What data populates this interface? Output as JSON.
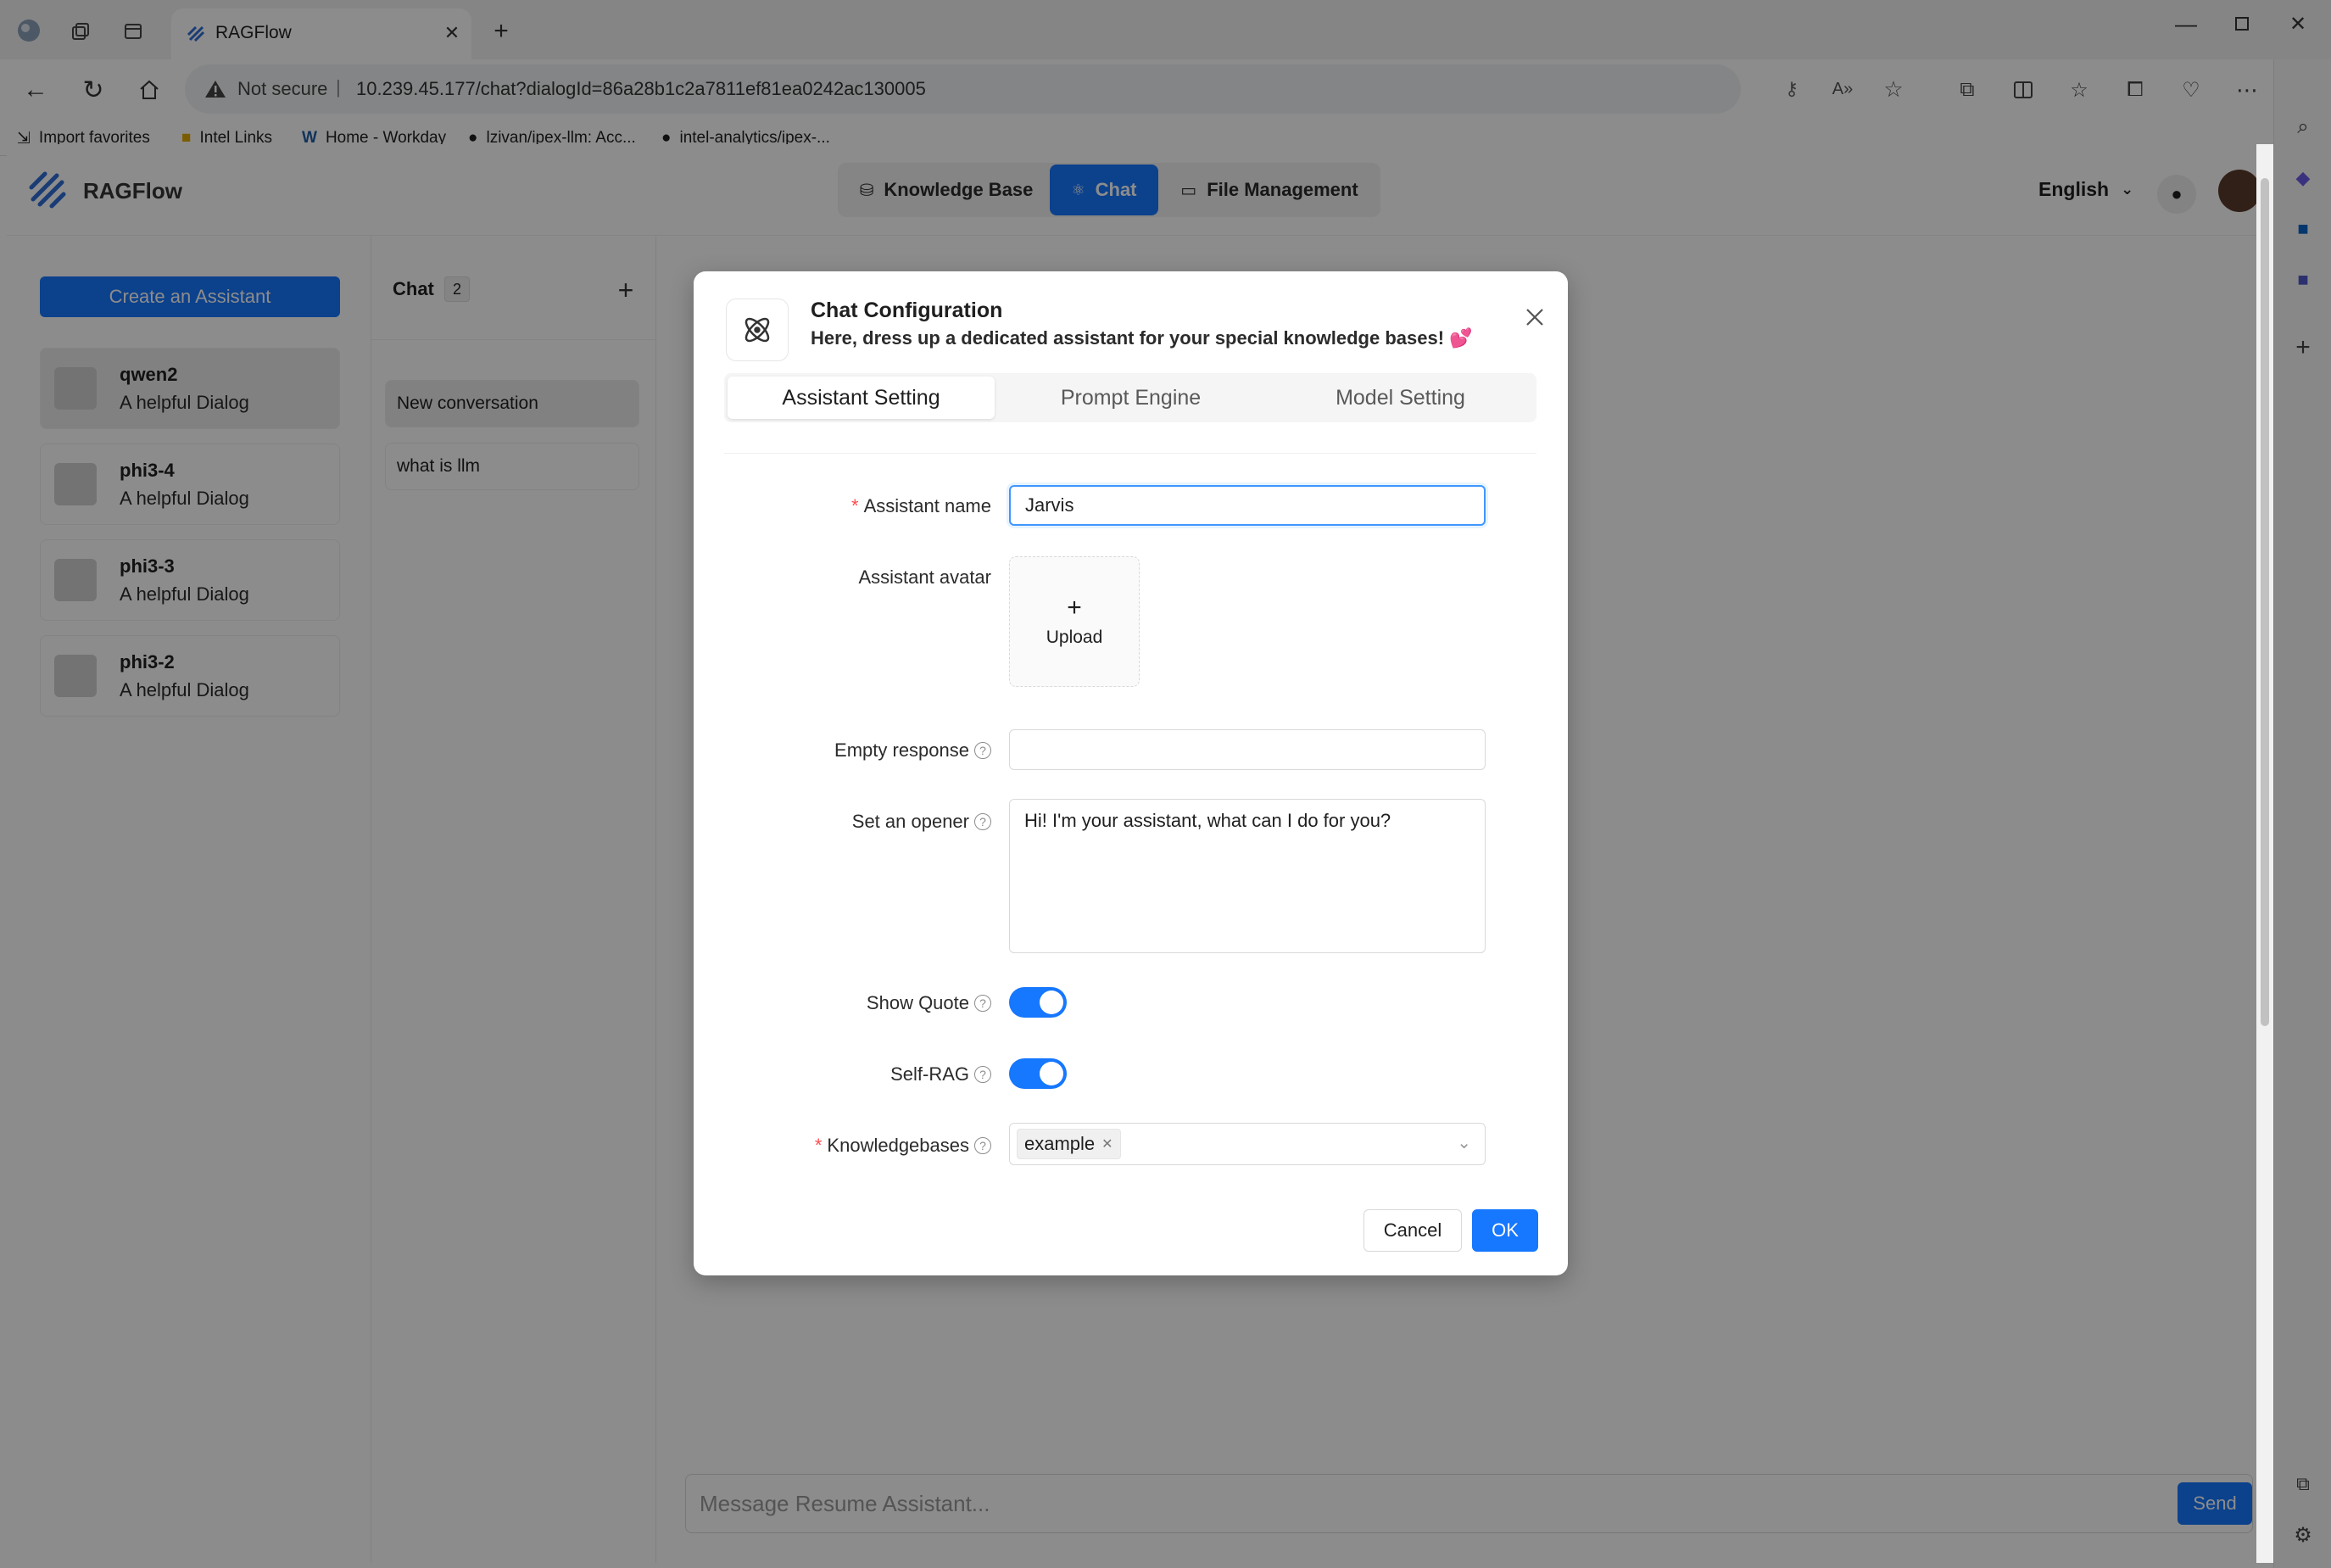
{
  "browser": {
    "tab_title": "RAGFlow",
    "security_label": "Not secure",
    "url": "10.239.45.177/chat?dialogId=86a28b1c2a7811ef81ea0242ac130005",
    "favorites": [
      "Import favorites",
      "Intel Links",
      "Home - Workday",
      "lzivan/ipex-llm: Acc...",
      "intel-analytics/ipex-..."
    ]
  },
  "app": {
    "brand": "RAGFlow",
    "nav": {
      "knowledge_base": "Knowledge Base",
      "chat": "Chat",
      "file_management": "File Management"
    },
    "language": "English",
    "create_assistant": "Create an Assistant",
    "assistants": [
      {
        "name": "qwen2",
        "desc": "A helpful Dialog"
      },
      {
        "name": "phi3-4",
        "desc": "A helpful Dialog"
      },
      {
        "name": "phi3-3",
        "desc": "A helpful Dialog"
      },
      {
        "name": "phi3-2",
        "desc": "A helpful Dialog"
      }
    ],
    "chat_header": "Chat",
    "chat_count": "2",
    "conversations": [
      "New conversation",
      "what is llm"
    ],
    "message_placeholder": "Message Resume Assistant...",
    "send": "Send"
  },
  "modal": {
    "title": "Chat Configuration",
    "subtitle": "Here, dress up a dedicated assistant for your special knowledge bases! 💕",
    "tabs": [
      "Assistant Setting",
      "Prompt Engine",
      "Model Setting"
    ],
    "active_tab": "Assistant Setting",
    "labels": {
      "assistant_name": "Assistant name",
      "assistant_avatar": "Assistant avatar",
      "empty_response": "Empty response",
      "opener": "Set an opener",
      "show_quote": "Show Quote",
      "self_rag": "Self-RAG",
      "knowledgebases": "Knowledgebases"
    },
    "values": {
      "assistant_name": "Jarvis",
      "empty_response": "",
      "opener": "Hi! I'm your assistant, what can I do for you?",
      "show_quote": true,
      "self_rag": true,
      "knowledgebase_tag": "example"
    },
    "upload_label": "Upload",
    "cancel": "Cancel",
    "ok": "OK"
  },
  "colors": {
    "primary": "#1677ff",
    "overlay": "rgba(0,0,0,0.45)",
    "required": "#ff4d4f"
  }
}
